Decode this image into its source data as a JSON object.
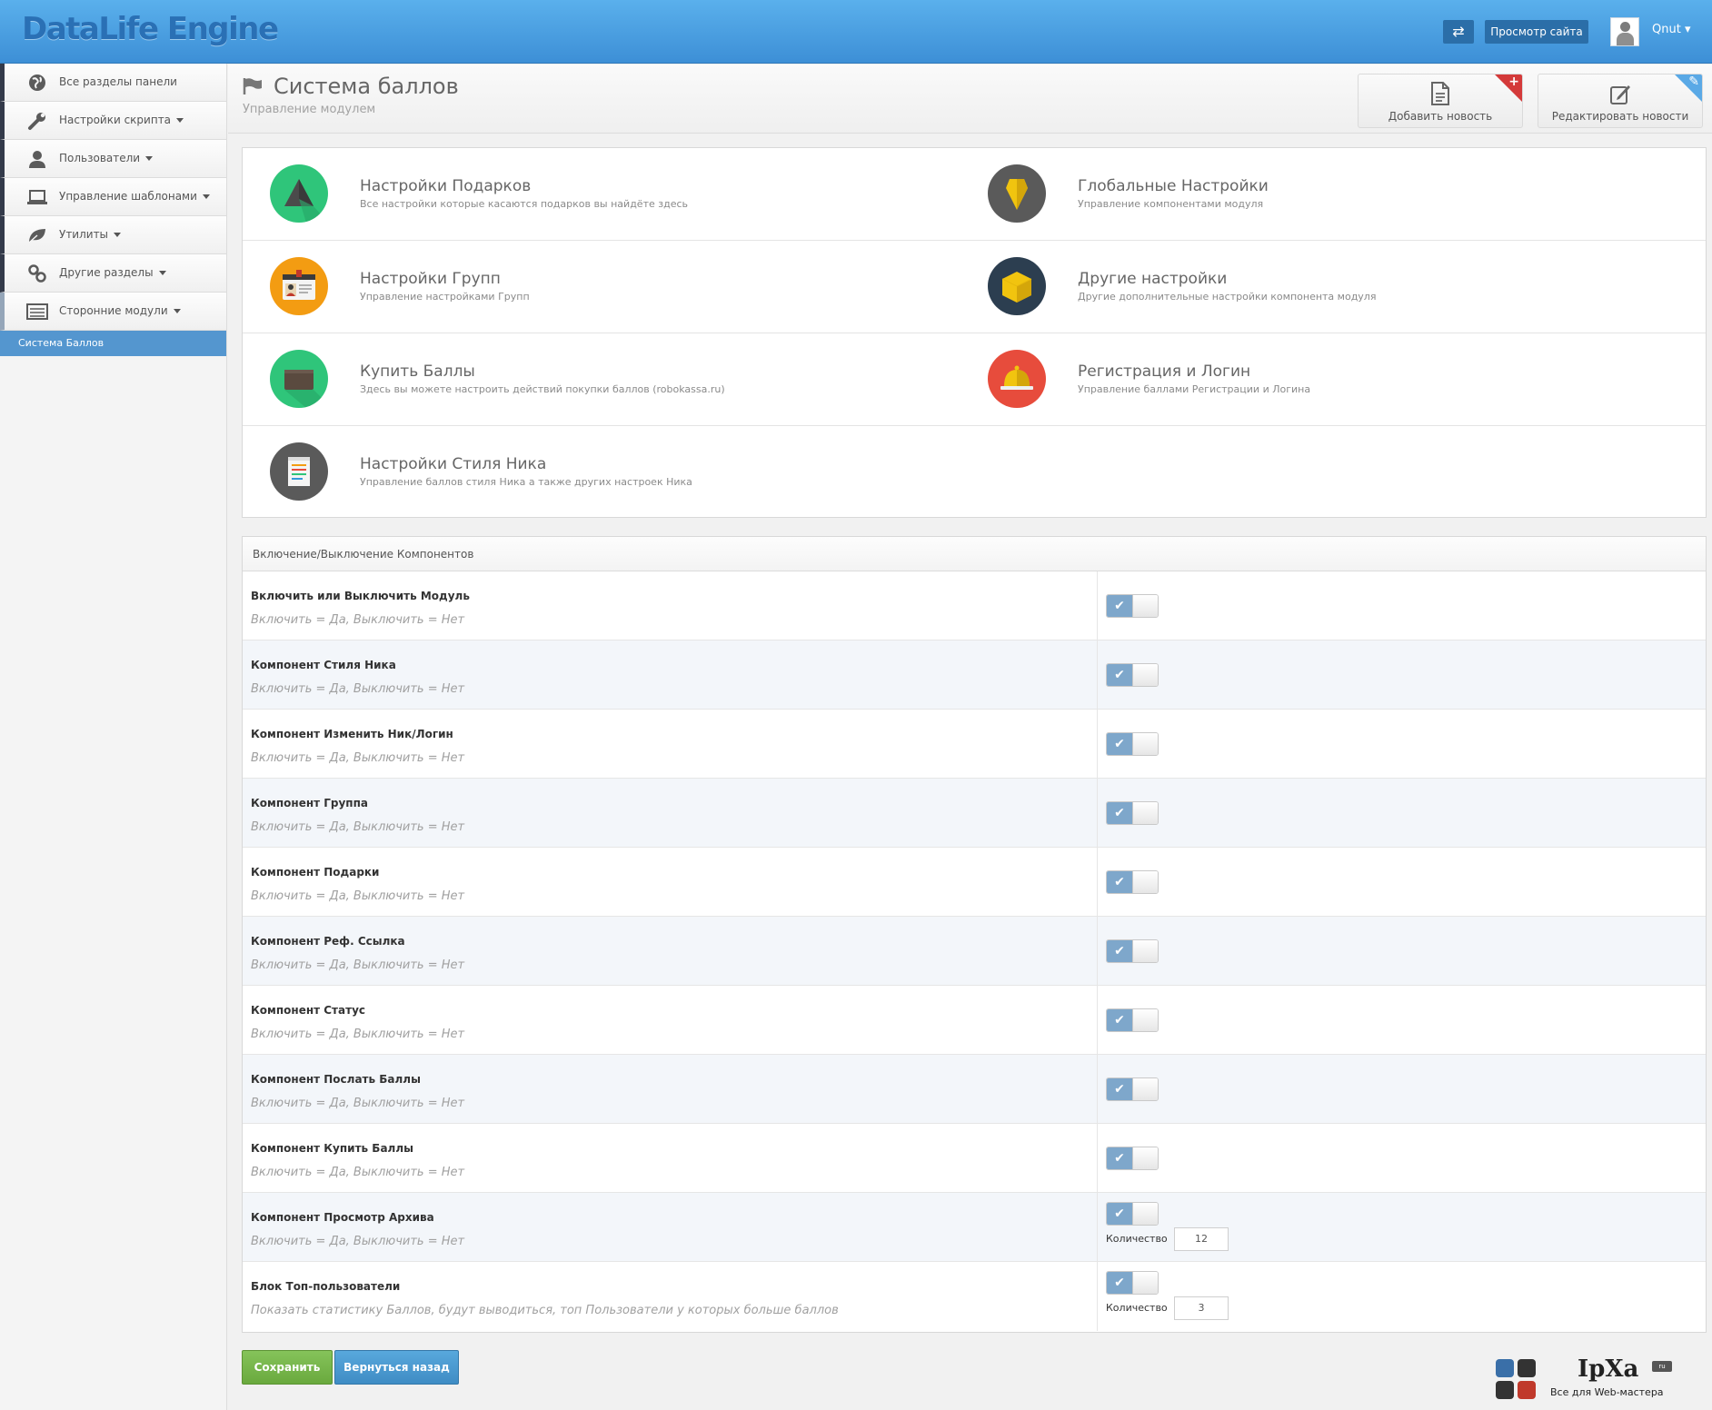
{
  "app": {
    "logo": "DataLife Engine",
    "view_site": "Просмотр сайта",
    "user": "Qnut ▾"
  },
  "sidebar": {
    "items": [
      {
        "label": "Все разделы панели",
        "caret": false
      },
      {
        "label": "Настройки скрипта",
        "caret": true
      },
      {
        "label": "Пользователи",
        "caret": true
      },
      {
        "label": "Управление шаблонами",
        "caret": true
      },
      {
        "label": "Утилиты",
        "caret": true
      },
      {
        "label": "Другие разделы",
        "caret": true
      },
      {
        "label": "Сторонние модули",
        "caret": true
      }
    ],
    "active_sub": "Система Баллов"
  },
  "page": {
    "title": "Система баллов",
    "subtitle": "Управление модулем"
  },
  "quick": {
    "add_news": "Добавить новость",
    "edit_news": "Редактировать новости"
  },
  "modules": [
    {
      "title": "Настройки Подарков",
      "desc": "Все настройки которые касаются подарков вы найдёте здесь",
      "color": "#2fc57a"
    },
    {
      "title": "Глобальные Настройки",
      "desc": "Управление компонентами модуля",
      "color": "#5a5a5a"
    },
    {
      "title": "Настройки Групп",
      "desc": "Управление настройками Групп",
      "color": "#f39c12"
    },
    {
      "title": "Другие настройки",
      "desc": "Другие дополнительные настройки компонента модуля",
      "color": "#2c3e50"
    },
    {
      "title": "Купить Баллы",
      "desc": "Здесь вы можете настроить действий покупки баллов (robokassa.ru)",
      "color": "#2fc57a"
    },
    {
      "title": "Регистрация и Логин",
      "desc": "Управление баллами Регистрации и Логина",
      "color": "#e74c3c"
    },
    {
      "title": "Настройки Стиля Ника",
      "desc": "Управление баллов стиля Ника а также других настроек Ника",
      "color": "#5a5a5a"
    }
  ],
  "options": {
    "header": "Включение/Выключение Компонентов",
    "qty_label": "Количество",
    "rows": [
      {
        "title": "Включить или Выключить Модуль",
        "desc": "Включить = Да, Выключить = Нет",
        "on": true
      },
      {
        "title": "Компонент Стиля Ника",
        "desc": "Включить = Да, Выключить = Нет",
        "on": true
      },
      {
        "title": "Компонент Изменить Ник/Логин",
        "desc": "Включить = Да, Выключить = Нет",
        "on": true
      },
      {
        "title": "Компонент Группа",
        "desc": "Включить = Да, Выключить = Нет",
        "on": true
      },
      {
        "title": "Компонент Подарки",
        "desc": "Включить = Да, Выключить = Нет",
        "on": true
      },
      {
        "title": "Компонент Реф. Ссылка",
        "desc": "Включить = Да, Выключить = Нет",
        "on": true
      },
      {
        "title": "Компонент Статус",
        "desc": "Включить = Да, Выключить = Нет",
        "on": true
      },
      {
        "title": "Компонент Послать Баллы",
        "desc": "Включить = Да, Выключить = Нет",
        "on": true
      },
      {
        "title": "Компонент Купить Баллы",
        "desc": "Включить = Да, Выключить = Нет",
        "on": true
      },
      {
        "title": "Компонент Просмотр Архива",
        "desc": "Включить = Да, Выключить = Нет",
        "on": true,
        "qty": "12"
      },
      {
        "title": "Блок Топ-пользователи",
        "desc": "Показать статистику Баллов, будут выводиться, топ Пользователи у которых больше баллов",
        "on": true,
        "qty": "3"
      }
    ]
  },
  "actions": {
    "save": "Сохранить",
    "back": "Вернуться назад"
  },
  "watermark": {
    "brand": "IpXa",
    "tld": "ru",
    "tagline": "Все для Web-мастера"
  }
}
